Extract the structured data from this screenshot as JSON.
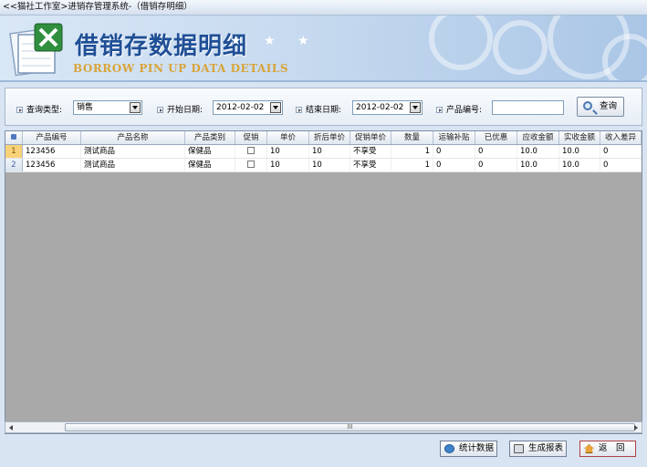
{
  "window": {
    "title": "<<猫社工作室>进销存管理系统-（借销存明细）"
  },
  "banner": {
    "title_cn": "借销存数据明细",
    "stars": "★ ★ ★",
    "title_en": "BORROW PIN UP DATA DETAILS"
  },
  "filters": {
    "query_type_label": "查询类型:",
    "query_type_value": "销售",
    "start_date_label": "开始日期:",
    "start_date_value": "2012-02-02",
    "end_date_label": "结束日期:",
    "end_date_value": "2012-02-02",
    "product_code_label": "产品编号:",
    "product_code_value": "",
    "query_button": "查询"
  },
  "grid": {
    "columns": [
      "产品编号",
      "产品名称",
      "产品类别",
      "促销",
      "单价",
      "折后单价",
      "促销单价",
      "数量",
      "运输补贴",
      "已优惠",
      "应收金额",
      "实收金额",
      "收入差异"
    ],
    "rows": [
      {
        "num": "1",
        "code": "123456",
        "name": "测试商品",
        "category": "保健品",
        "price": "10",
        "discount_price": "10",
        "promo_price": "不享受",
        "qty": "1",
        "shipping": "0",
        "discounted": "0",
        "receivable": "10.0",
        "received": "10.0",
        "diff": "0"
      },
      {
        "num": "2",
        "code": "123456",
        "name": "测试商品",
        "category": "保健品",
        "price": "10",
        "discount_price": "10",
        "promo_price": "不享受",
        "qty": "1",
        "shipping": "0",
        "discounted": "0",
        "receivable": "10.0",
        "received": "10.0",
        "diff": "0"
      }
    ]
  },
  "scrollbar": {
    "thumb_grip": "III"
  },
  "buttons": {
    "stats": "统计数据",
    "report": "生成报表",
    "back": "返　回"
  }
}
